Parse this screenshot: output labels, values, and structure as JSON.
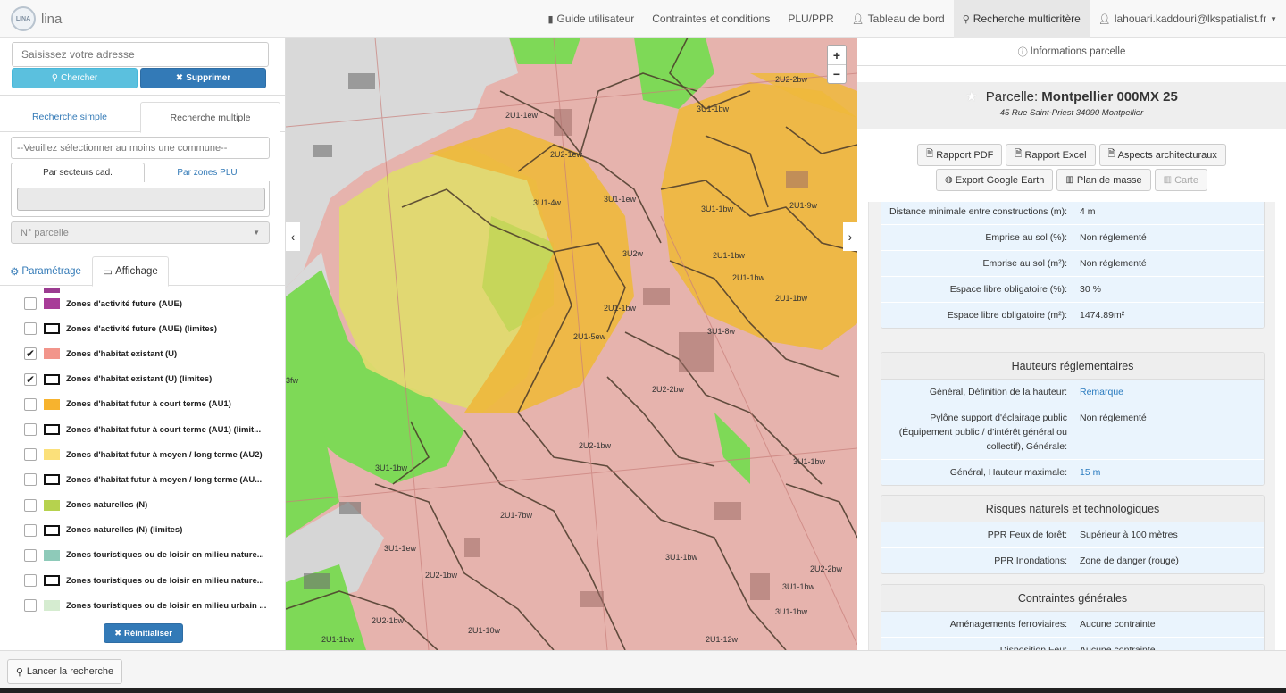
{
  "nav": {
    "logo_text": "LINA",
    "brand": "lina",
    "items": [
      {
        "label": "Guide utilisateur",
        "icon": "book-icon"
      },
      {
        "label": "Contraintes et conditions",
        "icon": ""
      },
      {
        "label": "PLU/PPR",
        "icon": ""
      },
      {
        "label": "Tableau de bord",
        "icon": "user-icon"
      },
      {
        "label": "Recherche multicritère",
        "icon": "search-icon"
      },
      {
        "label": "lahouari.kaddouri@lkspatialist.fr",
        "icon": "user-icon"
      }
    ]
  },
  "left": {
    "address_placeholder": "Saisissez votre adresse",
    "search_label": "Chercher",
    "delete_label": "Supprimer",
    "tabs": [
      "Recherche simple",
      "Recherche multiple"
    ],
    "commune_placeholder": "--Veuillez sélectionner au moins une commune--",
    "subtabs": [
      "Par secteurs cad.",
      "Par zones PLU"
    ],
    "parcel_placeholder": "N° parcelle",
    "tabs2": [
      "Paramétrage",
      "Affichage"
    ],
    "layers": [
      {
        "label": "Zones d'activité future (AUE)",
        "checked": false,
        "color": "#a83c98",
        "outline": false
      },
      {
        "label": "Zones d'activité future (AUE) (limites)",
        "checked": false,
        "color": "",
        "outline": true
      },
      {
        "label": "Zones d'habitat existant (U)",
        "checked": true,
        "color": "#f2958b",
        "outline": false
      },
      {
        "label": "Zones d'habitat existant (U) (limites)",
        "checked": true,
        "color": "",
        "outline": true
      },
      {
        "label": "Zones d'habitat futur à court terme (AU1)",
        "checked": false,
        "color": "#f7b32e",
        "outline": false
      },
      {
        "label": "Zones d'habitat futur à court terme (AU1) (limit...",
        "checked": false,
        "color": "",
        "outline": true
      },
      {
        "label": "Zones d'habitat futur à moyen / long terme (AU2)",
        "checked": false,
        "color": "#fbe07a",
        "outline": false
      },
      {
        "label": "Zones d'habitat futur à moyen / long terme (AU...",
        "checked": false,
        "color": "",
        "outline": true
      },
      {
        "label": "Zones naturelles (N)",
        "checked": false,
        "color": "#b6d24e",
        "outline": false
      },
      {
        "label": "Zones naturelles (N) (limites)",
        "checked": false,
        "color": "",
        "outline": true
      },
      {
        "label": "Zones touristiques ou de loisir en milieu nature...",
        "checked": false,
        "color": "#8ecab9",
        "outline": false
      },
      {
        "label": "Zones touristiques ou de loisir en milieu nature...",
        "checked": false,
        "color": "",
        "outline": true
      },
      {
        "label": "Zones touristiques ou de loisir en milieu urbain ...",
        "checked": false,
        "color": "#d5ecd0",
        "outline": false
      }
    ],
    "reset_label": "Réinitialiser",
    "checkmark": "✔"
  },
  "map": {
    "zoom_in": "+",
    "zoom_out": "−",
    "arrow_left": "‹",
    "arrow_right": "›",
    "labels": [
      "2U2-2bw",
      "3U1-1bw",
      "2U1-1ew",
      "2U2-1ew",
      "3U1-4w",
      "3U1-1ew",
      "3U1-1bw",
      "2U1-9w",
      "3U2w",
      "2U1-1bw",
      "2U1-1bw",
      "2U1-1bw",
      "2U1-1bw",
      "2U1-5ew",
      "3U1-8w",
      "2U2-2bw",
      "2U2-1bw",
      "3U1-1bw",
      "3U1-1bw",
      "2U1-7bw",
      "3U1-1ew",
      "3U1-1bw",
      "2U2-1bw",
      "3U1-1bw",
      "2U2-2bw",
      "2U2-1bw",
      "3U1-1bw",
      "2U1-1bw",
      "2U1-10w",
      "2U1-12w",
      "3fw"
    ]
  },
  "right": {
    "tab_label": "Informations parcelle",
    "parcel_prefix": "Parcelle:",
    "parcel_id": "Montpellier 000MX 25",
    "parcel_address": "45 Rue Saint-Priest 34090 Montpellier",
    "buttons_row1": [
      {
        "label": "Rapport PDF",
        "icon": "file-pdf-icon",
        "disabled": false
      },
      {
        "label": "Rapport Excel",
        "icon": "file-excel-icon",
        "disabled": false
      },
      {
        "label": "Aspects architecturaux",
        "icon": "file-icon",
        "disabled": false
      }
    ],
    "buttons_row2": [
      {
        "label": "Export Google Earth",
        "icon": "globe-icon",
        "disabled": false
      },
      {
        "label": "Plan de masse",
        "icon": "map-icon",
        "disabled": false
      },
      {
        "label": "Carte",
        "icon": "map-icon",
        "disabled": true
      }
    ],
    "panel1_rows": [
      {
        "k": "Distance minimale entre constructions (m):",
        "v": "4 m",
        "link": false
      },
      {
        "k": "Emprise au sol (%):",
        "v": "Non réglementé",
        "link": false
      },
      {
        "k": "Emprise au sol (m²):",
        "v": "Non réglementé",
        "link": false
      },
      {
        "k": "Espace libre obligatoire (%):",
        "v": "30 %",
        "link": false
      },
      {
        "k": "Espace libre obligatoire (m²):",
        "v": "1474.89m²",
        "link": false
      }
    ],
    "panel2": {
      "title": "Hauteurs réglementaires",
      "rows": [
        {
          "k": "Général, Définition de la hauteur:",
          "v": "Remarque",
          "link": true
        },
        {
          "k": "Pylône support d'éclairage public (Équipement public / d'intérêt général ou collectif), Générale:",
          "v": "Non réglementé",
          "link": false
        },
        {
          "k": "Général, Hauteur maximale:",
          "v": "15 m",
          "link": true
        }
      ]
    },
    "panel3": {
      "title": "Risques naturels et technologiques",
      "rows": [
        {
          "k": "PPR Feux de forêt:",
          "v": "Supérieur à 100 mètres",
          "link": false
        },
        {
          "k": "PPR Inondations:",
          "v": "Zone de danger (rouge)",
          "link": false
        }
      ]
    },
    "panel4": {
      "title": "Contraintes générales",
      "rows": [
        {
          "k": "Aménagements ferroviaires:",
          "v": "Aucune contrainte",
          "link": false
        },
        {
          "k": "Disposition Feu:",
          "v": "Aucune contrainte",
          "link": false
        }
      ]
    }
  },
  "footer": {
    "launch_label": "Lancer la recherche"
  },
  "colors": {
    "primary": "#337ab7",
    "info": "#5bc0de",
    "zone_u": "#e7b2ad",
    "zone_n": "#7ed957",
    "zone_au1": "#f0b93a",
    "zone_au2": "#e2d66b"
  }
}
